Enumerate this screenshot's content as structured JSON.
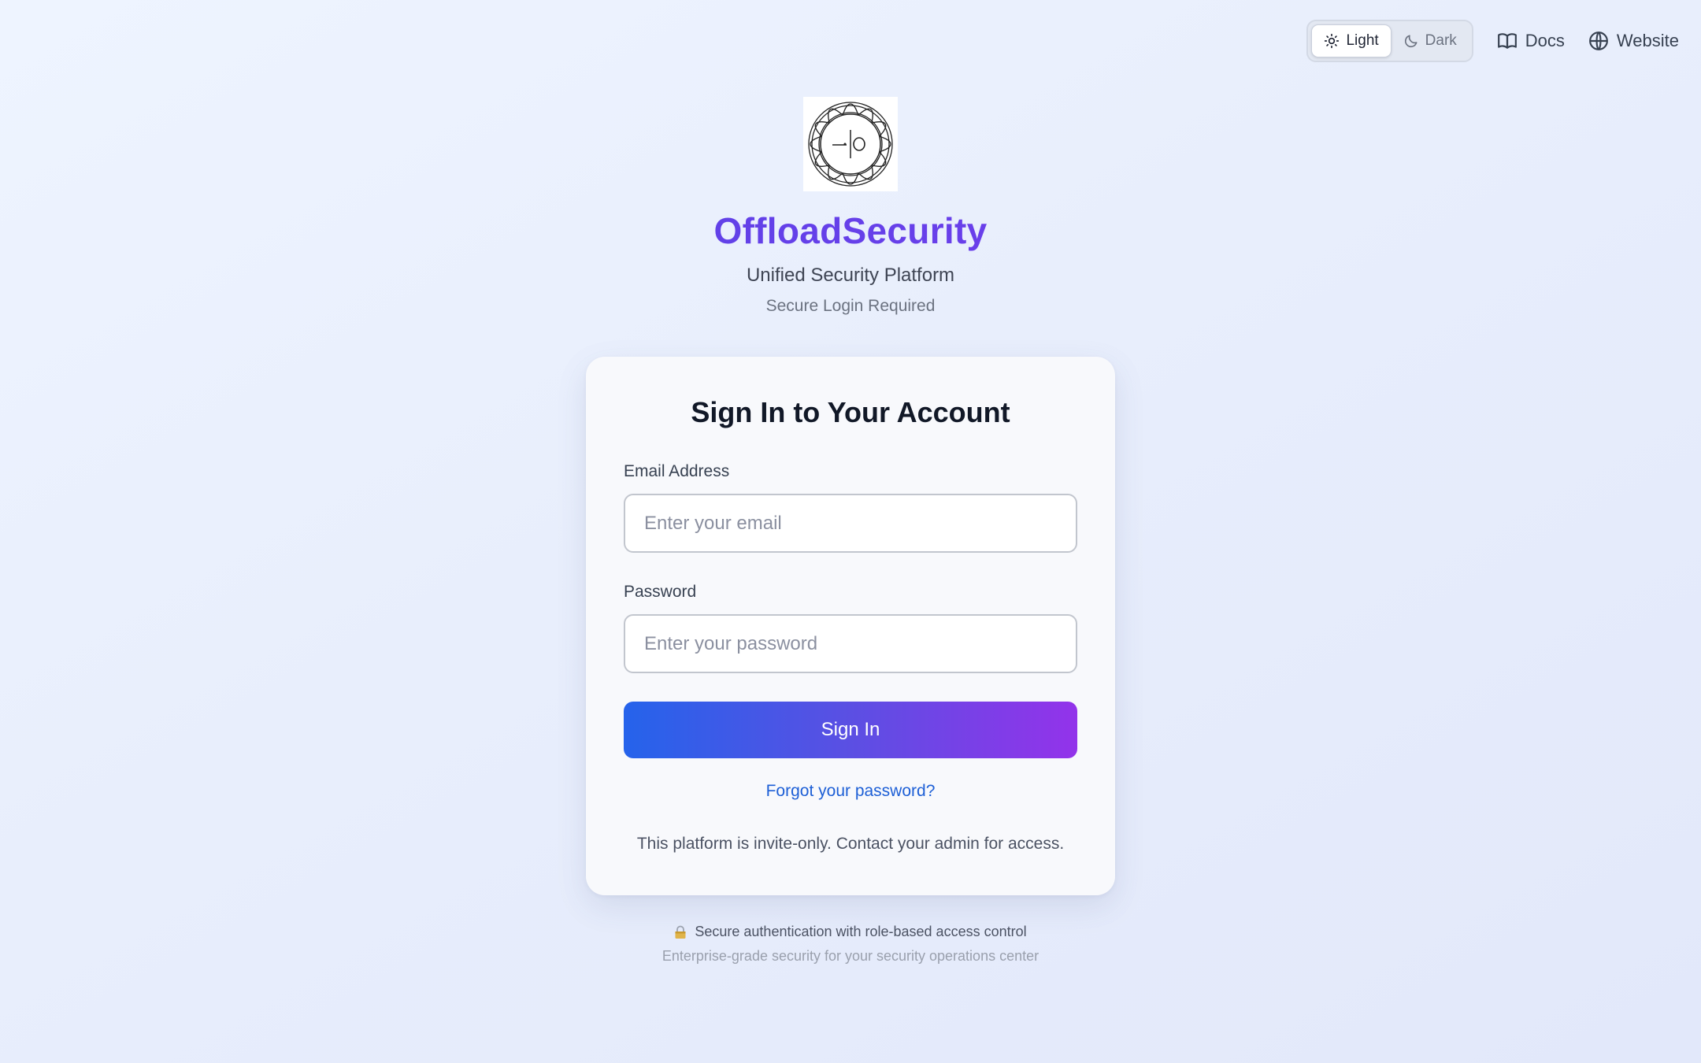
{
  "nav": {
    "theme_light": "Light",
    "theme_dark": "Dark",
    "active_theme": "Light",
    "docs": "Docs",
    "website": "Website",
    "icons": [
      "sun-icon",
      "moon-icon",
      "book-icon",
      "globe-icon"
    ]
  },
  "header": {
    "brand": "OffloadSecurity",
    "subtitle": "Unified Security Platform",
    "note": "Secure Login Required",
    "logo": "offload-security-logo"
  },
  "form": {
    "title": "Sign In to Your Account",
    "email_label": "Email Address",
    "email_placeholder": "Enter your email",
    "email_value": "",
    "password_label": "Password",
    "password_placeholder": "Enter your password",
    "password_value": "",
    "submit_label": "Sign In",
    "forgot_label": "Forgot your password?",
    "invite_note": "This platform is invite-only. Contact your admin for access."
  },
  "footer": {
    "line1": "Secure authentication with role-based access control",
    "line1_icon": "lock-icon",
    "line2": "Enterprise-grade security for your security operations center"
  },
  "colors": {
    "brand_gradient_start": "#4f46e5",
    "brand_gradient_end": "#7c3aed",
    "button_gradient_start": "#2563eb",
    "button_gradient_end": "#9333ea",
    "link": "#1d5fd6"
  }
}
